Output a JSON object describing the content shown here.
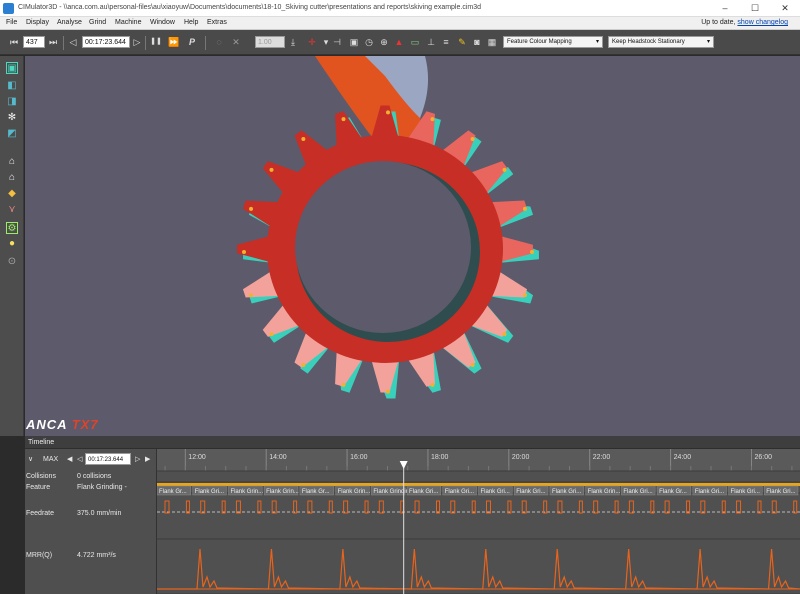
{
  "window": {
    "title": "CIMulator3D - \\\\anca.com.au\\personal-files\\au\\xiaoyuw\\Documents\\documents\\18-10_Skiving cutter\\presentations and reports\\skiving example.cim3d",
    "minimize": "–",
    "maximize": "☐",
    "close": "✕"
  },
  "menu": {
    "items": [
      "File",
      "Display",
      "Analyse",
      "Grind",
      "Machine",
      "Window",
      "Help",
      "Extras"
    ],
    "status_prefix": "Up to date,",
    "status_link": "show changelog"
  },
  "toolbar": {
    "frame_value": "437",
    "time_value": "00:17:23.644",
    "pause_label": "❚❚",
    "ffwd_label": "⏩",
    "p_label": "P",
    "speed_value": "1.00",
    "colour_mode": "Feature Colour Mapping",
    "headstock_mode": "Keep Headstock Stationary"
  },
  "left_toolbar": {
    "icons": [
      "cube-view-icon",
      "cube-front-icon",
      "cube-side-icon",
      "molecule-icon",
      "cube-iso-icon",
      "home-icon",
      "home-alt-icon",
      "grinder-icon",
      "axes-icon",
      "tool-active-icon",
      "bulb-icon",
      "target-icon"
    ]
  },
  "viewport": {
    "background": "#5d5a6b",
    "gear_colors": [
      "#c72e25",
      "#e9665e",
      "#f2a29b",
      "#39d0bb",
      "#f0b130"
    ],
    "tool_color": "#e2541f",
    "logo_main": "ANCA",
    "logo_accent": "TX7"
  },
  "timeline": {
    "title": "Timeline",
    "max_label": "MAX",
    "time_value": "00:17:23.644",
    "rows": [
      {
        "name": "Collisions",
        "value": "0 collisions"
      },
      {
        "name": "Feature",
        "value": "Flank Grinding -"
      },
      {
        "name": "Feedrate",
        "value": "375.0 mm/min"
      },
      {
        "name": "MRR(Q)",
        "value": "4.722 mm³/s"
      }
    ],
    "ticks": [
      "12:00",
      "14:00",
      "16:00",
      "18:00",
      "20:00",
      "22:00",
      "24:00",
      "26:00"
    ],
    "feature_segments": [
      "Flank Gr...",
      "Flank Gri...",
      "Flank Grin...",
      "Flank Grin...",
      "Flank Gr...",
      "Flank Grin...",
      "Flank Grinding...",
      "Flank Gri...",
      "Flank Gri...",
      "Flank Gri...",
      "Flank Gri...",
      "Flank Gri...",
      "Flank Grin...",
      "Flank Gri...",
      "Flank Gr...",
      "Flank Gri...",
      "Flank Gri...",
      "Flank Gri..."
    ],
    "colors": {
      "feature_bar": "#e8a51c",
      "feedrate": "#e8641c",
      "mrr": "#e8641c",
      "cursor": "#e0e0e0"
    }
  }
}
